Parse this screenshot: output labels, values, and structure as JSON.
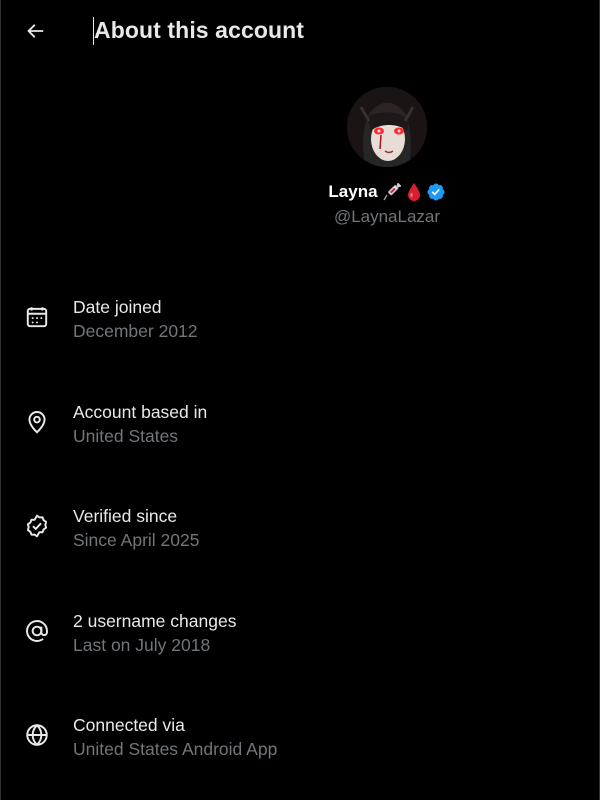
{
  "header": {
    "back_icon": "arrow-left-icon",
    "title": "About this account"
  },
  "profile": {
    "name": "Layna",
    "name_emojis": [
      "syringe-emoji",
      "drop-of-blood-emoji"
    ],
    "verified_badge": "verified-badge-icon",
    "handle": "@LaynaLazar"
  },
  "info": [
    {
      "icon": "calendar-icon",
      "label": "Date joined",
      "value": "December 2012"
    },
    {
      "icon": "location-pin-icon",
      "label": "Account based in",
      "value": "United States"
    },
    {
      "icon": "verified-check-icon",
      "label": "Verified since",
      "value": "Since April 2025"
    },
    {
      "icon": "at-sign-icon",
      "label": "2 username changes",
      "value": "Last on July 2018"
    },
    {
      "icon": "globe-icon",
      "label": "Connected via",
      "value": "United States Android App"
    }
  ],
  "colors": {
    "background": "#000000",
    "primary_text": "#e7e9ea",
    "secondary_text": "#71767b",
    "verified_blue": "#1d9bf0",
    "blood_red": "#d61f30"
  }
}
